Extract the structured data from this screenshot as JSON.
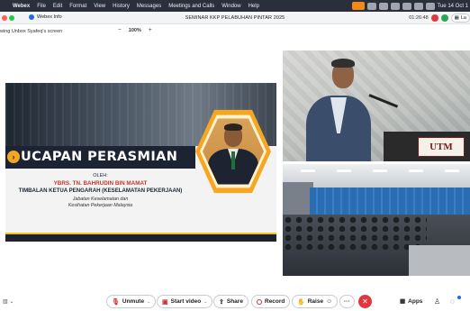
{
  "menubar": {
    "app": "Webex",
    "items": [
      "File",
      "Edit",
      "Format",
      "View",
      "History",
      "Messages",
      "Meetings and Calls",
      "Window",
      "Help"
    ],
    "clock": "Tue 14 Oct 1"
  },
  "titlebar": {
    "webex_info": "Webex Info",
    "meeting_title": "SEMINAR KKP PELABUHAN PINTAR 2025",
    "timer": "01:26:48",
    "layout_label": "La"
  },
  "viewbar": {
    "viewing": "wing Unbox Syafeq's screen",
    "zoom_out": "−",
    "zoom_value": "100%",
    "zoom_in": "+"
  },
  "slide": {
    "title": "UCAPAN PERASMIAN",
    "oleh": "OLEH:",
    "name": "YBRS. TN. BAHRUDIN BIN MAMAT",
    "role": "TIMBALAN KETUA PENGARAH (KESELAMATAN PEKERJAAN)",
    "dept_line1": "Jabatan Keselamatan dan",
    "dept_line2": "Kesihatan Pekerjaan Malaysia"
  },
  "video": {
    "podium_sign": "UTM"
  },
  "controls": {
    "unmute": "Unmute",
    "start_video": "Start video",
    "share": "Share",
    "record": "Record",
    "raise": "Raise",
    "more": "···",
    "leave": "✕",
    "apps": "Apps"
  },
  "colors": {
    "accent": "#f5a623",
    "slide_dark": "#1c2433",
    "leave_red": "#e0383e",
    "webex_blue": "#1b6be5"
  }
}
